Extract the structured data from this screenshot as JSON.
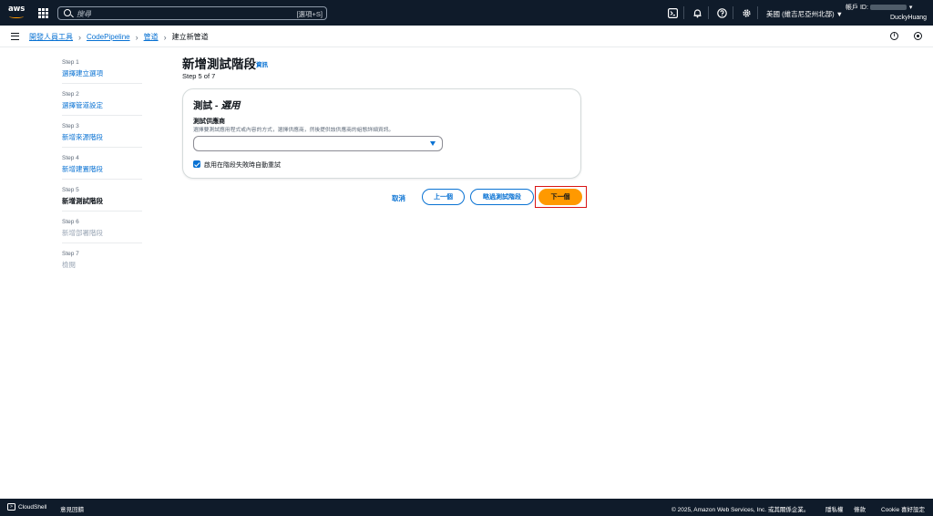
{
  "topnav": {
    "logo_text": "aws",
    "search_placeholder": "搜尋",
    "search_shortcut": "[選項+S]",
    "region": "美國 (維吉尼亞州北部) ▼",
    "account_label": "帳戶 ID:",
    "username": "DuckyHuang"
  },
  "breadcrumb": {
    "items": [
      "開發人員工具",
      "CodePipeline",
      "管道"
    ],
    "current": "建立新管道"
  },
  "steps": [
    {
      "num": "Step 1",
      "label": "選擇建立選項"
    },
    {
      "num": "Step 2",
      "label": "選擇管道設定"
    },
    {
      "num": "Step 3",
      "label": "新增來源階段"
    },
    {
      "num": "Step 4",
      "label": "新增建置階段"
    },
    {
      "num": "Step 5",
      "label": "新增測試階段"
    },
    {
      "num": "Step 6",
      "label": "新增部署階段"
    },
    {
      "num": "Step 7",
      "label": "檢閱"
    }
  ],
  "page": {
    "title": "新增測試階段",
    "info": "資訊",
    "step_count": "Step 5 of 7"
  },
  "panel": {
    "title": "測試 - ",
    "title_optional": "選用",
    "field_label": "測試供應商",
    "field_desc": "選擇要測試應用程式或內容的方式，選擇供應商，然後提供該供應商的組態詳細資訊。",
    "select_value": "",
    "checkbox_label": "啟用在階段失敗時自動重試"
  },
  "actions": {
    "cancel": "取消",
    "previous": "上一個",
    "skip": "略過測試階段",
    "next": "下一個"
  },
  "footer": {
    "cloudshell": "CloudShell",
    "feedback": "意見回饋",
    "copyright": "© 2025, Amazon Web Services, Inc. 或其關係企業。",
    "privacy": "隱私權",
    "terms": "條款",
    "cookie": "Cookie 喜好設定"
  },
  "colors": {
    "nav_bg": "#0f1b2a",
    "link": "#0972d3",
    "primary_button": "#ff9900",
    "highlight": "#d91515"
  }
}
